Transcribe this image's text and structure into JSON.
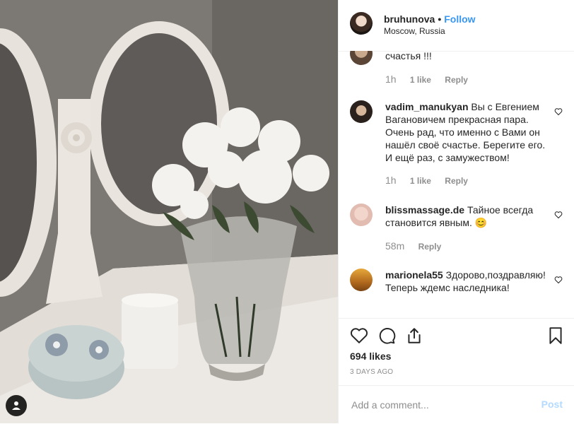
{
  "header": {
    "username": "bruhunova",
    "dot": "•",
    "follow_label": "Follow",
    "location": "Moscow, Russia"
  },
  "comments": [
    {
      "text": "счастья !!!",
      "time": "1h",
      "likes": "1 like",
      "reply": "Reply"
    },
    {
      "username": "vadim_manukyan",
      "text": "Вы с Евгением Вагановичем прекрасная пара. Очень рад, что именно с Вами он нашёл своё счастье. Берегите его. И ещё раз, с замужеством!",
      "time": "1h",
      "likes": "1 like",
      "reply": "Reply"
    },
    {
      "username": "blissmassage.de",
      "text": "Тайное всегда становится явным. 😊",
      "time": "58m",
      "reply": "Reply"
    },
    {
      "username": "marionela55",
      "text": "Здорово,поздравляю!Теперь ждемс наследника!"
    }
  ],
  "actions": {
    "likes": "694 likes",
    "date": "3 DAYS AGO"
  },
  "add_comment": {
    "placeholder": "Add a comment...",
    "post_label": "Post"
  },
  "colors": {
    "link": "#3897f0",
    "muted": "#8e8e8e",
    "post_disabled": "#b3dbff"
  }
}
